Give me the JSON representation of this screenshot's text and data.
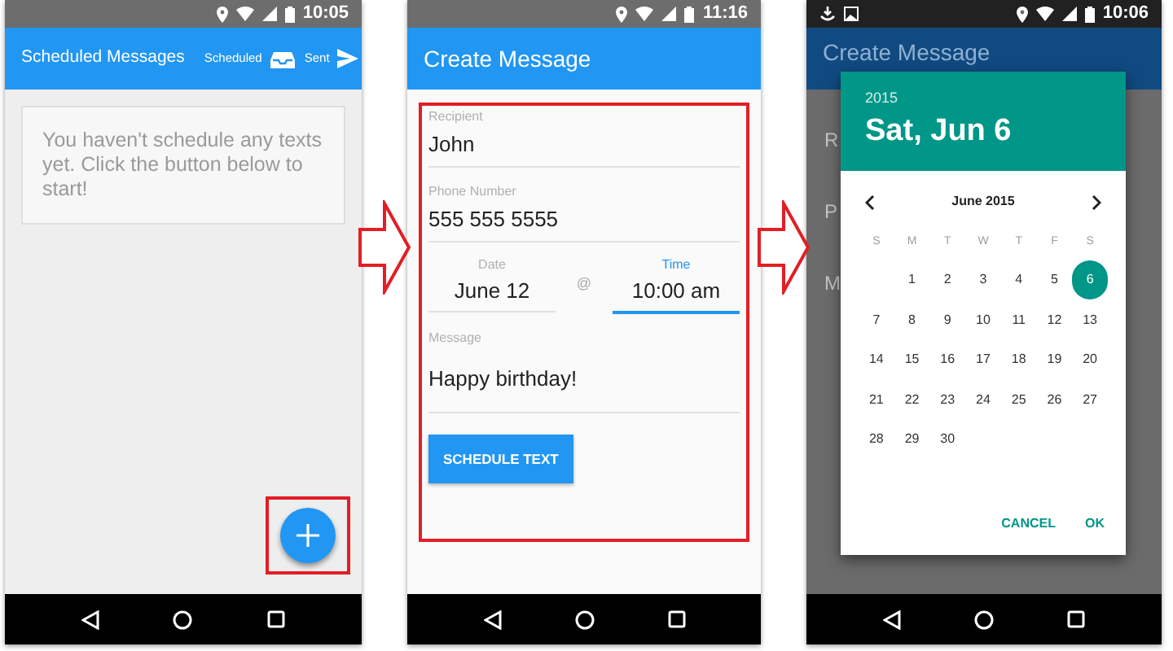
{
  "list_screen": {
    "status_bar": {
      "time": "10:05"
    },
    "app_bar": {
      "title": "Scheduled Messages",
      "actions": [
        {
          "label": "Scheduled"
        },
        {
          "label": "Sent"
        }
      ]
    },
    "empty_message": "You haven't schedule any texts yet. Click the button below to start!"
  },
  "create_screen": {
    "status_bar": {
      "time": "11:16"
    },
    "app_bar": {
      "title": "Create Message"
    },
    "recipient": {
      "label": "Recipient",
      "value": "John"
    },
    "phone": {
      "label": "Phone Number",
      "value": "555 555 5555"
    },
    "date": {
      "label": "Date",
      "value": "June 12",
      "focused": false
    },
    "separator": "@",
    "time": {
      "label": "Time",
      "value": "10:00 am",
      "focused": true
    },
    "message": {
      "label": "Message",
      "value": "Happy birthday!"
    },
    "button": "SCHEDULE TEXT"
  },
  "picker_screen": {
    "status_bar": {
      "time": "10:06"
    },
    "background": {
      "title": "Create Message",
      "field_fragments": [
        "R",
        "P",
        "M"
      ]
    },
    "dialog": {
      "year": "2015",
      "date": "Sat, Jun 6",
      "month": "June 2015",
      "weekdays": [
        "S",
        "M",
        "T",
        "W",
        "T",
        "F",
        "S"
      ],
      "weeks": [
        [
          {
            "day": "1",
            "selected": false
          },
          {
            "day": "2",
            "selected": false
          },
          {
            "day": "3",
            "selected": false
          },
          {
            "day": "4",
            "selected": false
          },
          {
            "day": "5",
            "selected": false
          },
          {
            "day": "6",
            "selected": true
          }
        ],
        [
          {
            "day": "7",
            "selected": false
          },
          {
            "day": "8",
            "selected": false
          },
          {
            "day": "9",
            "selected": false
          },
          {
            "day": "10",
            "selected": false
          },
          {
            "day": "11",
            "selected": false
          },
          {
            "day": "12",
            "selected": false
          },
          {
            "day": "13",
            "selected": false
          }
        ],
        [
          {
            "day": "14",
            "selected": false
          },
          {
            "day": "15",
            "selected": false
          },
          {
            "day": "16",
            "selected": false
          },
          {
            "day": "17",
            "selected": false
          },
          {
            "day": "18",
            "selected": false
          },
          {
            "day": "19",
            "selected": false
          },
          {
            "day": "20",
            "selected": false
          }
        ],
        [
          {
            "day": "21",
            "selected": false
          },
          {
            "day": "22",
            "selected": false
          },
          {
            "day": "23",
            "selected": false
          },
          {
            "day": "24",
            "selected": false
          },
          {
            "day": "25",
            "selected": false
          },
          {
            "day": "26",
            "selected": false
          },
          {
            "day": "27",
            "selected": false
          }
        ],
        [
          {
            "day": "28",
            "selected": false
          },
          {
            "day": "29",
            "selected": false
          },
          {
            "day": "30",
            "selected": false
          }
        ]
      ],
      "buttons": [
        "CANCEL",
        "OK"
      ]
    }
  }
}
